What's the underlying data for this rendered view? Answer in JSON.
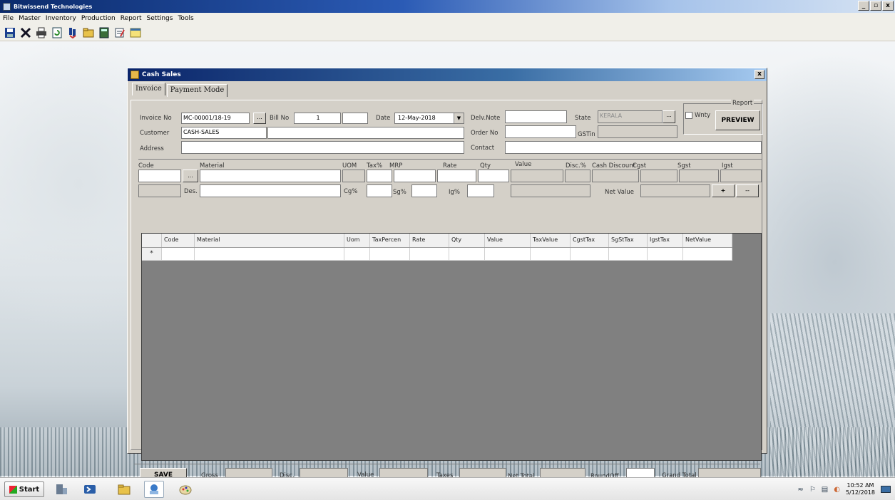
{
  "app": {
    "title": "Bitwissend Technologies",
    "win_min": "_",
    "win_max": "▫",
    "win_close": "x"
  },
  "menu": [
    "File",
    "Master",
    "Inventory",
    "Production",
    "Report",
    "Settings",
    "Tools"
  ],
  "toolbar_icons": [
    "save-icon",
    "delete-icon",
    "print-icon",
    "refresh-icon",
    "exit-icon",
    "folder-icon",
    "calculator-icon",
    "notes-icon",
    "window-icon"
  ],
  "window": {
    "title": "Cash Sales",
    "close": "x",
    "tabs": [
      "Invoice",
      "Payment Mode"
    ]
  },
  "header": {
    "invoice_no_label": "Invoice No",
    "invoice_no_value": "MC-00001/18-19",
    "ellipsis": "...",
    "bill_no_label": "Bill No",
    "bill_no_value": "1",
    "date_label": "Date",
    "date_value": "12-May-2018",
    "delv_note_label": "Delv.Note",
    "state_label": "State",
    "state_value": "KERALA",
    "report_group_label": "Report",
    "wnty_label": "Wnty",
    "preview_label": "PREVIEW",
    "customer_label": "Customer",
    "customer_value": "CASH-SALES",
    "order_no_label": "Order No",
    "gstin_label": "GSTin",
    "address_label": "Address",
    "contact_label": "Contact"
  },
  "entry": {
    "code": "Code",
    "material": "Material",
    "uom": "UOM",
    "tax": "Tax%",
    "mrp": "MRP",
    "rate": "Rate",
    "qty": "Qty",
    "value": "Value",
    "disc": "Disc.%",
    "cash_discount": "Cash Discount",
    "cgst": "Cgst",
    "sgst": "Sgst",
    "igst": "Igst",
    "des": "Des.",
    "cg": "Cg%",
    "sg": "Sg%",
    "ig": "Ig%",
    "net_value": "Net Value",
    "add": "+",
    "remove": "--"
  },
  "grid": {
    "columns": [
      "Code",
      "Material",
      "Uom",
      "TaxPercen",
      "Rate",
      "Qty",
      "Value",
      "TaxValue",
      "CgstTax",
      "SgStTax",
      "IgstTax",
      "NetValue"
    ],
    "new_row_marker": "*"
  },
  "footer": {
    "save": "SAVE",
    "gross": "Gross",
    "disc": "Disc.",
    "value": "Value",
    "taxes": "Taxes",
    "net_total": "Net Total",
    "round_off": "RoundOff.",
    "grand_total": "Grand Total"
  },
  "taskbar": {
    "start": "Start",
    "time": "10:52 AM",
    "date": "5/12/2018"
  }
}
